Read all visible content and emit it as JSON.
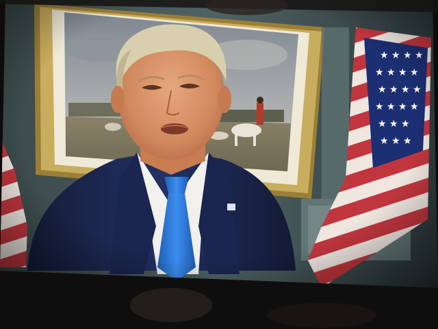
{
  "scene": {
    "kind": "photo-of-screen",
    "subject": "man in dark suit and blue tie speaking to camera",
    "tie_color": "#2a78d8",
    "suit_color": "#1d2a52",
    "flag_red": "#b03038",
    "flag_blue": "#1c2f73",
    "frame_gold": "#b79a4a"
  }
}
